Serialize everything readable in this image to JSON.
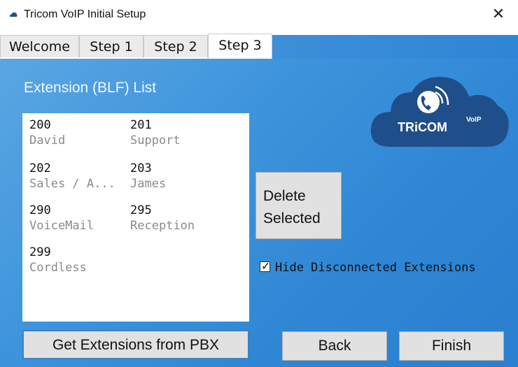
{
  "window": {
    "title": "Tricom VoIP Initial Setup",
    "close_glyph": "✕"
  },
  "tabs": [
    {
      "label": "Welcome",
      "active": false
    },
    {
      "label": "Step 1",
      "active": false
    },
    {
      "label": "Step 2",
      "active": false
    },
    {
      "label": "Step 3",
      "active": true
    }
  ],
  "panel": {
    "title": "Extension (BLF) List",
    "extensions": [
      {
        "number": "200",
        "name": "David"
      },
      {
        "number": "201",
        "name": "Support"
      },
      {
        "number": "202",
        "name": "Sales / A..."
      },
      {
        "number": "203",
        "name": "James"
      },
      {
        "number": "290",
        "name": "VoiceMail"
      },
      {
        "number": "295",
        "name": "Reception"
      },
      {
        "number": "299",
        "name": "Cordless"
      }
    ],
    "delete_button": {
      "line1": "Delete",
      "line2": "Selected"
    },
    "hide_disconnected": {
      "label": "Hide Disconnected Extensions",
      "checked": true
    },
    "get_extensions_button": "Get Extensions from PBX",
    "back_button": "Back",
    "finish_button": "Finish",
    "logo": {
      "brand": "TRiCOM",
      "superscript": "VoIP",
      "icon": "phone-cloud-icon"
    }
  },
  "colors": {
    "panel": "#3f95dc",
    "logo_cloud": "#1f4f8a"
  }
}
